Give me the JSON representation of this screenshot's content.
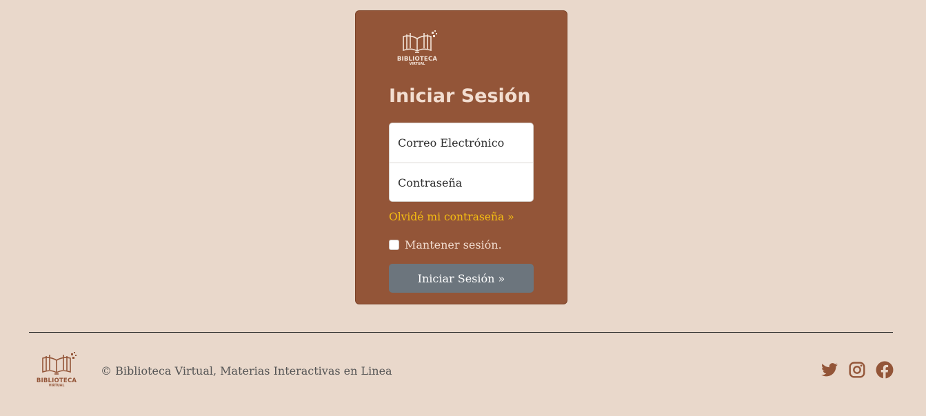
{
  "login": {
    "logo_name": "BIBLIOTECA",
    "logo_sub": "VIRTUAL",
    "title": "Iniciar Sesión",
    "email_placeholder": "Correo Electrónico",
    "password_placeholder": "Contraseña",
    "forgot_link": "Olvidé mi contraseña »",
    "remember_label": "Mantener sesión.",
    "remember_checked": false,
    "submit_label": "Iniciar Sesión »"
  },
  "footer": {
    "logo_name": "BIBLIOTECA",
    "logo_sub": "VIRTUAL",
    "copyright": "© Biblioteca Virtual, Materias Interactivas en Linea",
    "social_icons": [
      "twitter-icon",
      "instagram-icon",
      "facebook-icon"
    ]
  },
  "colors": {
    "background": "#e9d8cb",
    "card": "#935538",
    "accent_link": "#f5bd12",
    "button": "#6c757d"
  }
}
